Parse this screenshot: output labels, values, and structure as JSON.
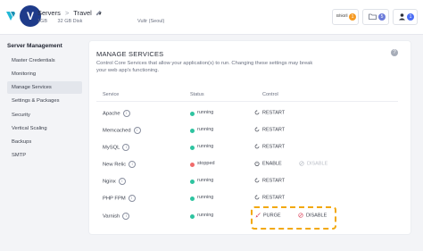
{
  "header": {
    "breadcrumb": {
      "servers": "Servers",
      "separator": ">",
      "current": "Travel"
    },
    "server_specs": [
      "1GB",
      "32 GB Disk"
    ],
    "server_location": "Vultr (Seoul)",
    "actions": [
      {
        "label": "Bhktrll",
        "badge": "1",
        "badge_color": "#f59a23"
      },
      {
        "label": "",
        "badge": "5",
        "badge_color": "#6c7bd9"
      },
      {
        "label": "",
        "badge": "1",
        "badge_color": "#4c6ef5"
      }
    ],
    "brand_color": "#1e3b8a",
    "logo_color": "#22b8d6"
  },
  "sidebar": {
    "title": "Server Management",
    "items": [
      {
        "label": "Master Credentials",
        "active": false
      },
      {
        "label": "Monitoring",
        "active": false
      },
      {
        "label": "Manage Services",
        "active": true
      },
      {
        "label": "Settings & Packages",
        "active": false
      },
      {
        "label": "Security",
        "active": false
      },
      {
        "label": "Vertical Scaling",
        "active": false
      },
      {
        "label": "Backups",
        "active": false
      },
      {
        "label": "SMTP",
        "active": false
      }
    ]
  },
  "main": {
    "title": "MANAGE SERVICES",
    "description": "Control Core Services that allow your application(s) to run. Changing these settings may break your web app's functioning.",
    "columns": {
      "service": "Service",
      "status": "Status",
      "control": "Control"
    },
    "services": [
      {
        "name": "Apache",
        "status": "running",
        "controls": [
          "RESTART"
        ]
      },
      {
        "name": "Memcached",
        "status": "running",
        "controls": [
          "RESTART"
        ]
      },
      {
        "name": "MySQL",
        "status": "running",
        "controls": [
          "RESTART"
        ]
      },
      {
        "name": "New Relic",
        "status": "stopped",
        "controls": [
          "ENABLE",
          "DISABLE"
        ]
      },
      {
        "name": "Nginx",
        "status": "running",
        "controls": [
          "RESTART"
        ]
      },
      {
        "name": "PHP FPM",
        "status": "running",
        "controls": [
          "RESTART"
        ]
      },
      {
        "name": "Varnish",
        "status": "running",
        "controls": [
          "PURGE",
          "DISABLE"
        ]
      }
    ],
    "status_colors": {
      "running": "#2ec4a0",
      "stopped": "#f06b6b"
    },
    "highlight_color": "#f2a80c"
  }
}
